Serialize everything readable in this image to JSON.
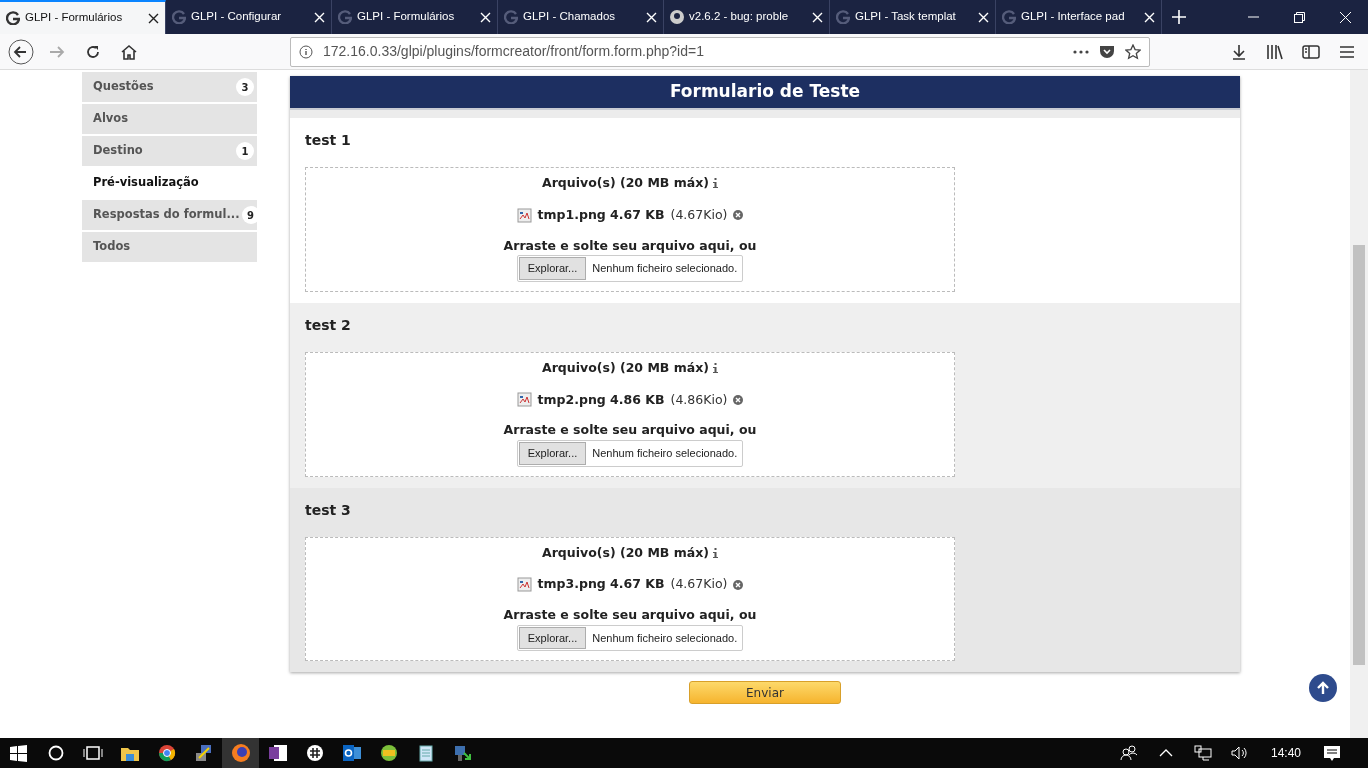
{
  "browser_tabs": [
    {
      "title": "GLPI - Formulários",
      "selected": true,
      "kind": "glpi"
    },
    {
      "title": "GLPI - Configurar",
      "selected": false,
      "kind": "glpi"
    },
    {
      "title": "GLPI - Formulários",
      "selected": false,
      "kind": "glpi"
    },
    {
      "title": "GLPI - Chamados",
      "selected": false,
      "kind": "glpi"
    },
    {
      "title": "v2.6.2 - bug: proble",
      "selected": false,
      "kind": "github"
    },
    {
      "title": "GLPI - Task templat",
      "selected": false,
      "kind": "glpi"
    },
    {
      "title": "GLPI - Interface pad",
      "selected": false,
      "kind": "glpi"
    }
  ],
  "address_bar": {
    "url": "172.16.0.33/glpi/plugins/formcreator/front/form.form.php?id=1"
  },
  "sidebar": {
    "items": [
      {
        "label": "Questões",
        "badge": "3",
        "selected": false
      },
      {
        "label": "Alvos",
        "selected": false
      },
      {
        "label": "Destino",
        "badge": "1",
        "selected": false
      },
      {
        "label": "Pré-visualização",
        "selected": true
      },
      {
        "label": "Respostas do formul...",
        "badge": "9",
        "selected": false
      },
      {
        "label": "Todos",
        "selected": false
      }
    ]
  },
  "form": {
    "title": "Formulario de Teste",
    "sections": [
      {
        "title": "test 1",
        "field_label": "Arquivo(s) (20 MB máx)",
        "file_name": "tmp1.png 4.67 KB",
        "file_size": "(4.67Kio)",
        "drop_text": "Arraste e solte seu arquivo aqui, ou",
        "browse_button": "Explorar...",
        "no_file": "Nenhum ficheiro selecionado."
      },
      {
        "title": "test 2",
        "field_label": "Arquivo(s) (20 MB máx)",
        "file_name": "tmp2.png 4.86 KB",
        "file_size": "(4.86Kio)",
        "drop_text": "Arraste e solte seu arquivo aqui, ou",
        "browse_button": "Explorar...",
        "no_file": "Nenhum ficheiro selecionado."
      },
      {
        "title": "test 3",
        "field_label": "Arquivo(s) (20 MB máx)",
        "file_name": "tmp3.png 4.67 KB",
        "file_size": "(4.67Kio)",
        "drop_text": "Arraste e solte seu arquivo aqui, ou",
        "browse_button": "Explorar...",
        "no_file": "Nenhum ficheiro selecionado."
      }
    ],
    "submit": "Enviar"
  },
  "taskbar": {
    "clock": "14:40"
  }
}
